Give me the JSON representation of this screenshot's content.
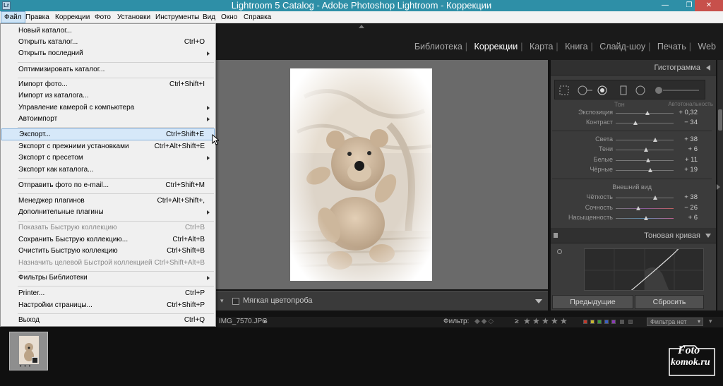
{
  "window": {
    "title": "Lightroom 5 Catalog - Adobe Photoshop Lightroom - Коррекции",
    "app_icon": "Lr",
    "minimize": "—",
    "maximize": "❐",
    "close": "✕"
  },
  "menubar": [
    "Файл",
    "Правка",
    "Коррекции",
    "Фото",
    "Установки",
    "Инструменты",
    "Вид",
    "Окно",
    "Справка"
  ],
  "modules": [
    "Библиотека",
    "Коррекции",
    "Карта",
    "Книга",
    "Слайд-шоу",
    "Печать",
    "Web"
  ],
  "file_menu": {
    "items": [
      {
        "label": "Новый каталог...",
        "shortcut": ""
      },
      {
        "label": "Открыть каталог...",
        "shortcut": "Ctrl+O"
      },
      {
        "label": "Открыть последний",
        "shortcut": ""
      },
      {
        "label": "Оптимизировать каталог...",
        "shortcut": ""
      },
      {
        "label": "Импорт фото...",
        "shortcut": "Ctrl+Shift+I"
      },
      {
        "label": "Импорт из каталога...",
        "shortcut": ""
      },
      {
        "label": "Управление камерой с компьютера",
        "shortcut": ""
      },
      {
        "label": "Автоимпорт",
        "shortcut": ""
      },
      {
        "label": "Экспорт...",
        "shortcut": "Ctrl+Shift+E"
      },
      {
        "label": "Экспорт с прежними установками",
        "shortcut": "Ctrl+Alt+Shift+E"
      },
      {
        "label": "Экспорт с пресетом",
        "shortcut": ""
      },
      {
        "label": "Экспорт как каталога...",
        "shortcut": ""
      },
      {
        "label": "Отправить фото по e-mail...",
        "shortcut": "Ctrl+Shift+M"
      },
      {
        "label": "Менеджер плагинов",
        "shortcut": "Ctrl+Alt+Shift+,"
      },
      {
        "label": "Дополнительные плагины",
        "shortcut": ""
      },
      {
        "label": "Показать Быструю коллекцию",
        "shortcut": "Ctrl+B"
      },
      {
        "label": "Сохранить Быструю коллекцию...",
        "shortcut": "Ctrl+Alt+B"
      },
      {
        "label": "Очистить Быструю коллекцию",
        "shortcut": "Ctrl+Shift+B"
      },
      {
        "label": "Назначить целевой Быстрой коллекцией",
        "shortcut": "Ctrl+Shift+Alt+B"
      },
      {
        "label": "Фильтры Библиотеки",
        "shortcut": ""
      },
      {
        "label": "Printer...",
        "shortcut": "Ctrl+P"
      },
      {
        "label": "Настройки страницы...",
        "shortcut": "Ctrl+Shift+P"
      },
      {
        "label": "Выход",
        "shortcut": "Ctrl+Q"
      }
    ]
  },
  "right_panel": {
    "histogram_title": "Гистограмма",
    "tone_label": "Тон",
    "auto_label": "Автотональность",
    "sliders": [
      {
        "label": "Экспозиция",
        "value": "+ 0,32",
        "pos": 0.56
      },
      {
        "label": "Контраст",
        "value": "− 34",
        "pos": 0.33
      },
      {
        "label": "Света",
        "value": "+ 38",
        "pos": 0.69
      },
      {
        "label": "Тени",
        "value": "+ 6",
        "pos": 0.53
      },
      {
        "label": "Белые",
        "value": "+ 11",
        "pos": 0.56
      },
      {
        "label": "Чёрные",
        "value": "+ 19",
        "pos": 0.6
      },
      {
        "label": "Чёткость",
        "value": "+ 38",
        "pos": 0.69
      },
      {
        "label": "Сочность",
        "value": "− 26",
        "pos": 0.37
      },
      {
        "label": "Насыщенность",
        "value": "+ 6",
        "pos": 0.53
      }
    ],
    "presence_title": "Внешний вид",
    "tone_curve_title": "Тоновая кривая",
    "prev_button": "Предыдущие",
    "reset_button": "Сбросить"
  },
  "toolbar": {
    "soft_proof_label": "Мягкая цветопроба"
  },
  "filterbar": {
    "filename": "IMG_7570.JPG",
    "filter_label": "Фильтр:",
    "filter_select": "Фильтра нет",
    "rating_op": "≥"
  },
  "filmstrip": {
    "dots": "• • •"
  },
  "watermark": {
    "line1": "Foto",
    "line2": "komok.ru"
  },
  "colors": {
    "titlebar": "#2e8fa7",
    "label_red": "#c0392b",
    "label_yellow": "#c8b630",
    "label_green": "#3a9a3a",
    "label_blue": "#3b5fc0",
    "label_purple": "#8a3ab5"
  }
}
